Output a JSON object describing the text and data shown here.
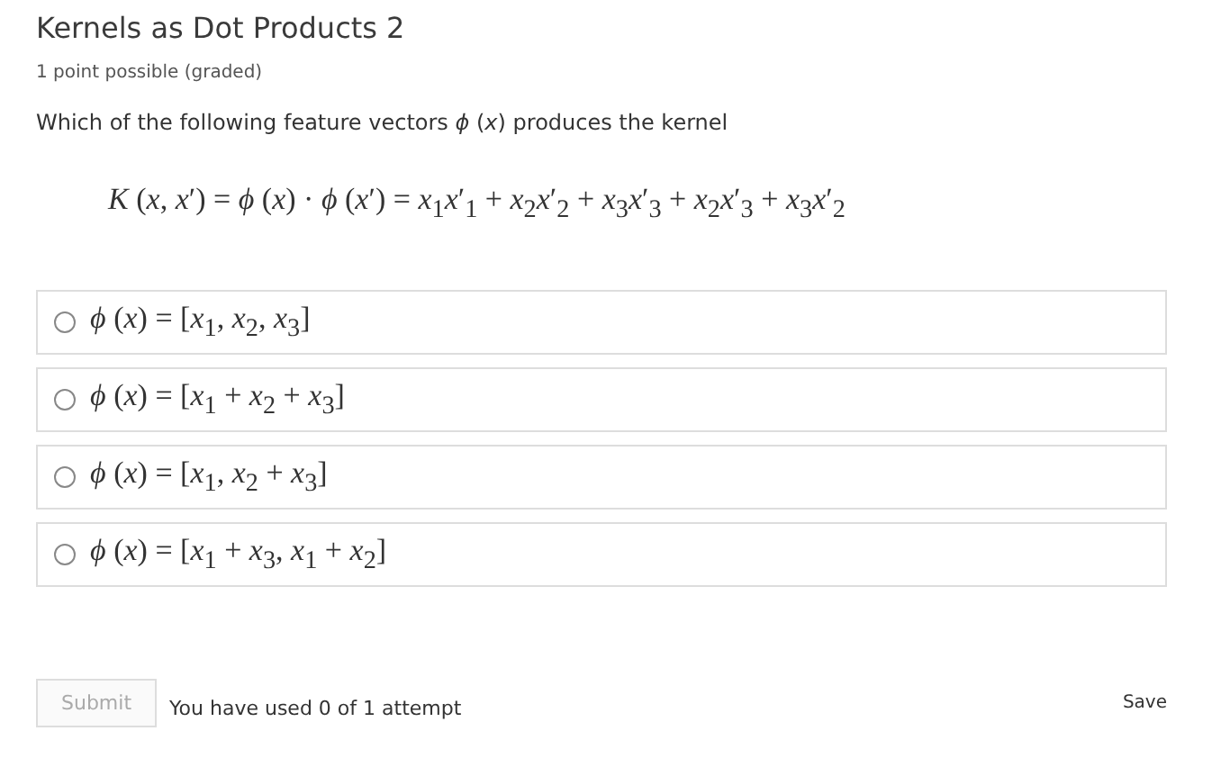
{
  "problem": {
    "title": "Kernels as Dot Products 2",
    "subtitle": "1 point possible (graded)",
    "question": "Which of the following feature vectors *ϕ* (*x*) produces the kernel",
    "formula": "*K* (*x*, *x*′) = *ϕ* (*x*) · *ϕ* (*x*′) = *x*$_{1}$*x*′$_{1}$ + *x*$_{2}$*x*′$_{2}$ + *x*$_{3}$*x*′$_{3}$ + *x*$_{2}$*x*′$_{3}$ + *x*$_{3}$*x*′$_{2}$",
    "options": [
      {
        "label": "*ϕ* (*x*) = [*x*$_{1}$, *x*$_{2}$, *x*$_{3}$]",
        "selected": false
      },
      {
        "label": "*ϕ* (*x*) = [*x*$_{1}$ + *x*$_{2}$ + *x*$_{3}$]",
        "selected": false
      },
      {
        "label": "*ϕ* (*x*) = [*x*$_{1}$, *x*$_{2}$ + *x*$_{3}$]",
        "selected": false
      },
      {
        "label": "*ϕ* (*x*) = [*x*$_{1}$ + *x*$_{3}$, *x*$_{1}$ + *x*$_{2}$]",
        "selected": false
      }
    ]
  },
  "footer": {
    "submit": {
      "label": "Submit",
      "disabled": true
    },
    "attempts": "You have used 0 of 1 attempt",
    "save": "Save"
  }
}
